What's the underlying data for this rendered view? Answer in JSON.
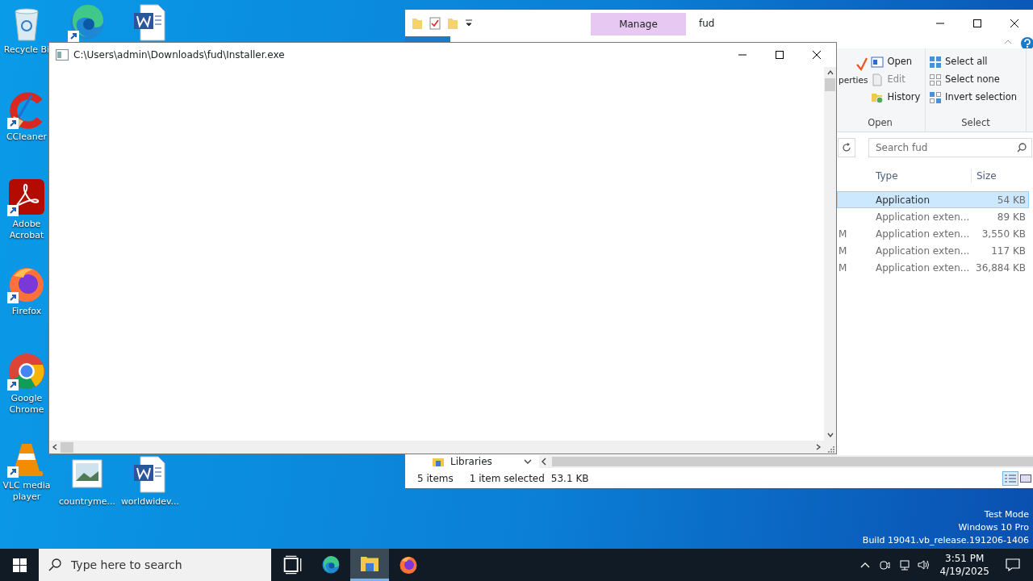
{
  "desktop": {
    "icons": [
      {
        "kind": "recycle",
        "label": "Recycle Bi",
        "shortcut": false
      },
      {
        "kind": "ccleaner",
        "label": "CCleaner",
        "shortcut": true
      },
      {
        "kind": "acrobat",
        "label": "Adobe Acrobat",
        "shortcut": true
      },
      {
        "kind": "firefox",
        "label": "Firefox",
        "shortcut": true
      },
      {
        "kind": "chrome",
        "label": "Google Chrome",
        "shortcut": true
      },
      {
        "kind": "vlc",
        "label": "VLC media player",
        "shortcut": true
      },
      {
        "kind": "edge",
        "shortcut": true
      },
      {
        "kind": "image",
        "label": "countryme..."
      },
      {
        "kind": "word",
        "shortcut": false
      },
      {
        "kind": "word",
        "label": "worldwidev..."
      }
    ],
    "os_notice": [
      "Test Mode",
      "Windows 10 Pro",
      "Build 19041.vb_release.191206-1406"
    ]
  },
  "explorer": {
    "title": "fud",
    "context_tab": "Manage",
    "open_group": {
      "name": "Open",
      "partial_button": "perties",
      "items": [
        {
          "kind": "open",
          "label": "Open",
          "disabled": false
        },
        {
          "kind": "edit",
          "label": "Edit",
          "disabled": true
        },
        {
          "kind": "history",
          "label": "History",
          "disabled": false
        }
      ]
    },
    "select_group": {
      "name": "Select",
      "items": [
        {
          "kind": "all",
          "label": "Select all"
        },
        {
          "kind": "none",
          "label": "Select none"
        },
        {
          "kind": "invert",
          "label": "Invert selection"
        }
      ]
    },
    "search": {
      "placeholder": "Search fud"
    },
    "columns": [
      "Type",
      "Size"
    ],
    "rows": [
      {
        "type": "Application",
        "size": "54 KB",
        "selected": true
      },
      {
        "type": "Application exten...",
        "size": "89 KB",
        "selected": false
      },
      {
        "fragment": "M",
        "type": "Application exten...",
        "size": "3,550 KB",
        "selected": false
      },
      {
        "fragment": "M",
        "type": "Application exten...",
        "size": "117 KB",
        "selected": false
      },
      {
        "fragment": "M",
        "type": "Application exten...",
        "size": "36,884 KB",
        "selected": false
      }
    ],
    "nav_item": "Libraries",
    "status": {
      "count": "5 items",
      "selection": "1 item selected",
      "size": "53.1 KB"
    }
  },
  "installer": {
    "title": "C:\\Users\\admin\\Downloads\\fud\\Installer.exe"
  },
  "taskbar": {
    "search": {
      "placeholder": "Type here to search"
    },
    "apps": [
      {
        "kind": "taskview",
        "selected": false
      },
      {
        "kind": "edge",
        "selected": false
      },
      {
        "kind": "explorer",
        "selected": true
      },
      {
        "kind": "firefox",
        "selected": false
      }
    ],
    "time": "3:51 PM",
    "date": "4/19/2025"
  }
}
